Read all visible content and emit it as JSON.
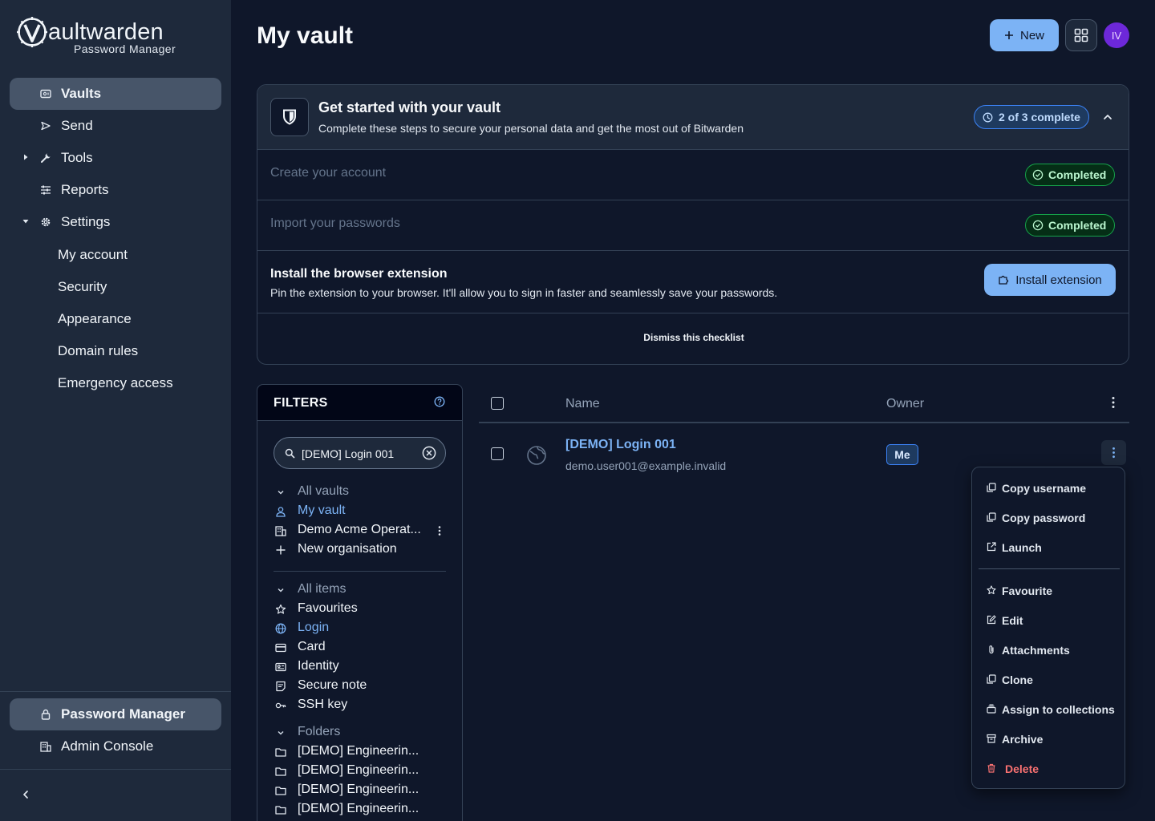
{
  "app": {
    "logo_name": "aultwarden",
    "logo_sub": "Password Manager"
  },
  "sidebar": {
    "items": [
      {
        "label": "Vaults",
        "icon": "vault-icon",
        "active": true
      },
      {
        "label": "Send",
        "icon": "send-icon"
      },
      {
        "label": "Tools",
        "icon": "wrench-icon"
      },
      {
        "label": "Reports",
        "icon": "reports-icon"
      },
      {
        "label": "Settings",
        "icon": "gear-icon"
      }
    ],
    "settings_items": [
      "My account",
      "Security",
      "Appearance",
      "Domain rules",
      "Emergency access"
    ],
    "products": [
      {
        "label": "Password Manager",
        "icon": "lock-icon",
        "active": true
      },
      {
        "label": "Admin Console",
        "icon": "building-icon"
      }
    ]
  },
  "header": {
    "title": "My vault",
    "new_label": "New",
    "avatar_initials": "IV"
  },
  "checklist": {
    "title": "Get started with your vault",
    "subtitle": "Complete these steps to secure your personal data and get the most out of Bitwarden",
    "progress": "2 of 3 complete",
    "steps": [
      {
        "label": "Create your account",
        "status": "Completed"
      },
      {
        "label": "Import your passwords",
        "status": "Completed"
      }
    ],
    "extension_title": "Install the browser extension",
    "extension_desc": "Pin the extension to your browser. It'll allow you to sign in faster and seamlessly save your passwords.",
    "install_label": "Install extension",
    "dismiss_label": "Dismiss this checklist"
  },
  "filters": {
    "title": "FILTERS",
    "search_value": "[DEMO] Login 001",
    "vaults_head": "All vaults",
    "vaults": [
      "My vault",
      "Demo Acme Operat...",
      "New organisation"
    ],
    "items_head": "All items",
    "types": [
      "Favourites",
      "Login",
      "Card",
      "Identity",
      "Secure note",
      "SSH key"
    ],
    "folders_head": "Folders",
    "folders": [
      "[DEMO] Engineerin...",
      "[DEMO] Engineerin...",
      "[DEMO] Engineerin...",
      "[DEMO] Engineerin..."
    ]
  },
  "table": {
    "col_name": "Name",
    "col_owner": "Owner",
    "rows": [
      {
        "name": "[DEMO] Login 001",
        "username": "demo.user001@example.invalid",
        "owner": "Me"
      }
    ]
  },
  "row_menu": {
    "items": [
      "Copy username",
      "Copy password",
      "Launch",
      "Favourite",
      "Edit",
      "Attachments",
      "Clone",
      "Assign to collections",
      "Archive",
      "Delete"
    ]
  },
  "colors": {
    "accent": "#7cb3f5",
    "sidebar_bg": "#1e293b",
    "page_bg": "#0f172a",
    "success": "#16a34a",
    "danger": "#f87171"
  }
}
